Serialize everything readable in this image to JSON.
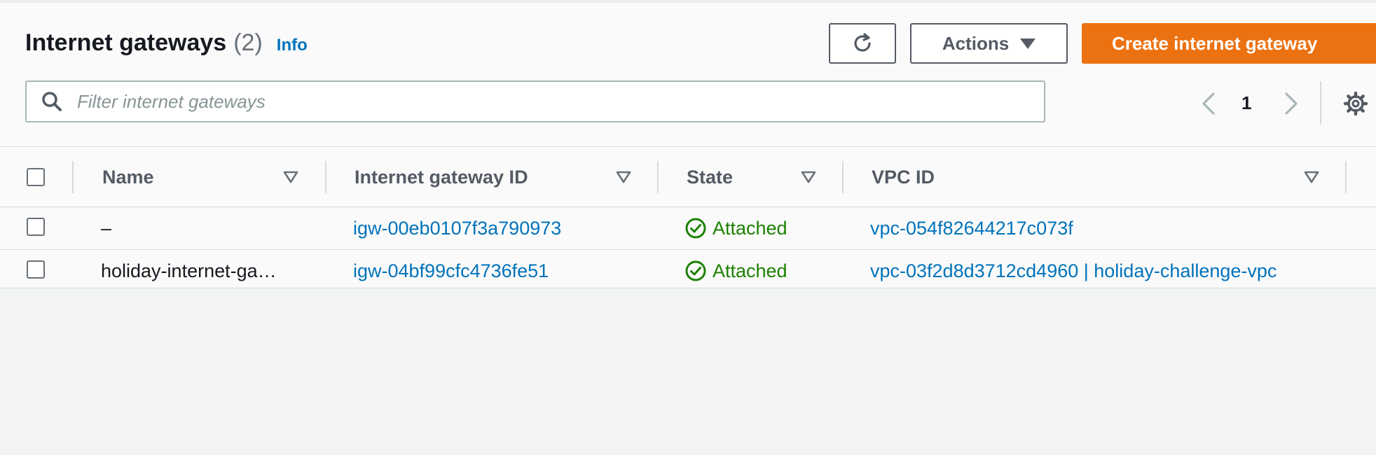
{
  "header": {
    "title": "Internet gateways",
    "count": "(2)",
    "info": "Info"
  },
  "toolbar": {
    "actions_label": "Actions",
    "create_label": "Create internet gateway"
  },
  "search": {
    "placeholder": "Filter internet gateways",
    "value": ""
  },
  "pagination": {
    "current_page": "1"
  },
  "icons": [
    "search-icon",
    "refresh-icon",
    "caret-down-icon",
    "chevron-left-icon",
    "chevron-right-icon",
    "gear-icon",
    "sort-icon",
    "check-circle-icon"
  ],
  "colors": {
    "accent": "#ec7211",
    "link": "#0073bb",
    "success": "#1d8102",
    "border": "#aab7b8"
  },
  "table": {
    "columns": [
      "Name",
      "Internet gateway ID",
      "State",
      "VPC ID"
    ],
    "rows": [
      {
        "name": "–",
        "gateway_id": "igw-00eb0107f3a790973",
        "state": "Attached",
        "vpc_id": "vpc-054f82644217c073f"
      },
      {
        "name": "holiday-internet-ga…",
        "gateway_id": "igw-04bf99cfc4736fe51",
        "state": "Attached",
        "vpc_id": "vpc-03f2d8d3712cd4960 | holiday-challenge-vpc"
      }
    ]
  }
}
